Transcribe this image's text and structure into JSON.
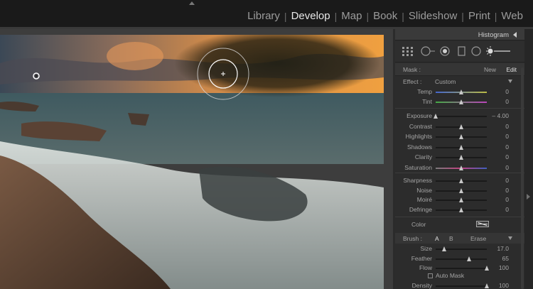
{
  "modules": {
    "items": [
      "Library",
      "Develop",
      "Map",
      "Book",
      "Slideshow",
      "Print",
      "Web"
    ],
    "active": "Develop"
  },
  "panel": {
    "histogram_label": "Histogram",
    "mask": {
      "label": "Mask :",
      "new": "New",
      "edit": "Edit"
    },
    "effect": {
      "label": "Effect :",
      "value": "Custom"
    },
    "sliders_a": [
      {
        "label": "Temp",
        "value": "0",
        "pos": 0.5
      },
      {
        "label": "Tint",
        "value": "0",
        "pos": 0.5
      }
    ],
    "sliders_b": [
      {
        "label": "Exposure",
        "value": "– 4.00",
        "pos": 0.0
      },
      {
        "label": "Contrast",
        "value": "0",
        "pos": 0.5
      },
      {
        "label": "Highlights",
        "value": "0",
        "pos": 0.5
      },
      {
        "label": "Shadows",
        "value": "0",
        "pos": 0.5
      },
      {
        "label": "Clarity",
        "value": "0",
        "pos": 0.5
      },
      {
        "label": "Saturation",
        "value": "0",
        "pos": 0.5
      }
    ],
    "sliders_c": [
      {
        "label": "Sharpness",
        "value": "0",
        "pos": 0.5
      },
      {
        "label": "Noise",
        "value": "0",
        "pos": 0.5
      },
      {
        "label": "Moiré",
        "value": "0",
        "pos": 0.5
      },
      {
        "label": "Defringe",
        "value": "0",
        "pos": 0.5
      }
    ],
    "color_label": "Color",
    "brush": {
      "label": "Brush :",
      "a": "A",
      "b": "B",
      "erase": "Erase"
    },
    "brush_sliders": [
      {
        "label": "Size",
        "value": "17.0",
        "pos": 0.17
      },
      {
        "label": "Feather",
        "value": "65",
        "pos": 0.65
      },
      {
        "label": "Flow",
        "value": "100",
        "pos": 1.0
      }
    ],
    "auto_mask": "Auto Mask",
    "density": {
      "label": "Density",
      "value": "100",
      "pos": 1.0
    }
  },
  "colors": {
    "accent": "#e8e8e8",
    "panel_bg": "#2c2c2c",
    "topbar_bg": "#1a1a1a"
  }
}
